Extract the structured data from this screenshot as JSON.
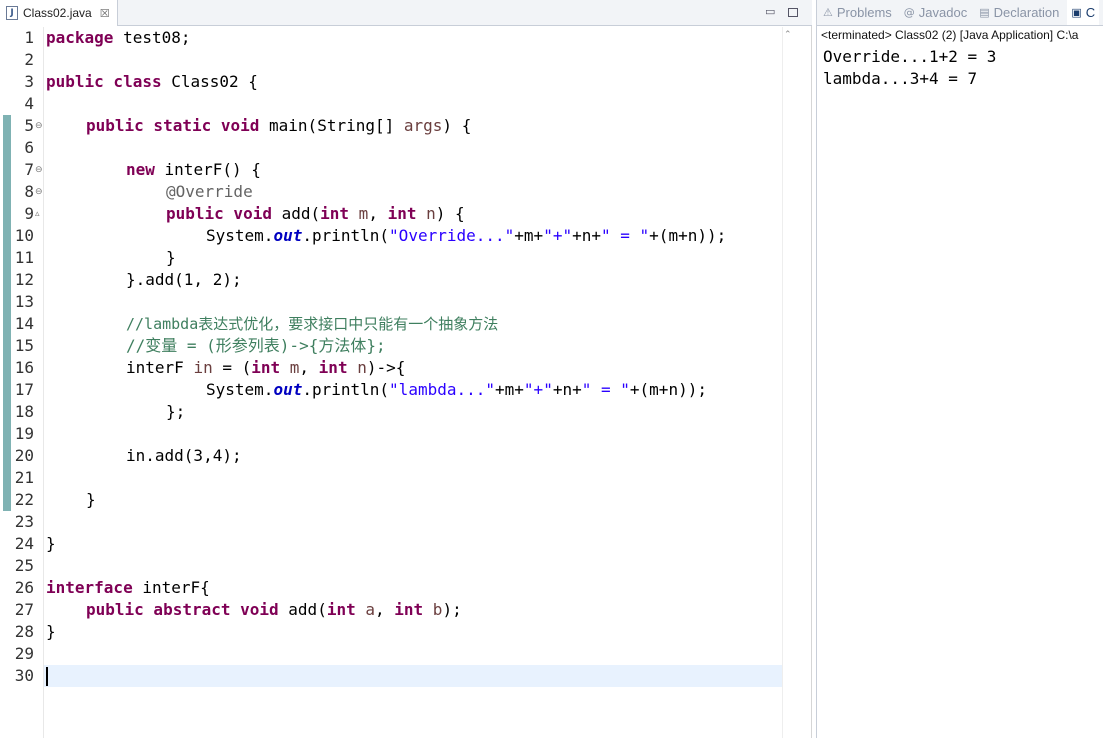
{
  "editor": {
    "tab_label": "Class02.java",
    "tab_close": "☒",
    "minimize": "▭"
  },
  "code": {
    "line_numbers": [
      "1",
      "2",
      "3",
      "4",
      "5",
      "6",
      "7",
      "8",
      "9",
      "10",
      "11",
      "12",
      "13",
      "14",
      "15",
      "16",
      "17",
      "18",
      "19",
      "20",
      "21",
      "22",
      "23",
      "24",
      "25",
      "26",
      "27",
      "28",
      "29",
      "30"
    ],
    "fold_markers": {
      "5": "⊖",
      "7": "⊖",
      "8": "⊖",
      "9": "▵"
    },
    "l1_kw": "package",
    "l1_rest": " test08;",
    "l3_kw": "public class",
    "l3_rest": " Class02 {",
    "l5_kw": "public static void",
    "l5_a": " main(String[] ",
    "l5_prm": "args",
    "l5_b": ") {",
    "l7_kw": "new",
    "l7_rest": " interF() {",
    "l8_ann": "@Override",
    "l9_kw1": "public void",
    "l9_a": " add(",
    "l9_kw2": "int",
    "l9_prm1": " m",
    "l9_b": ", ",
    "l9_kw3": "int",
    "l9_prm2": " n",
    "l9_c": ") {",
    "l10_a": "System.",
    "l10_fld": "out",
    "l10_b": ".println(",
    "l10_s1": "\"Override...\"",
    "l10_c": "+m+",
    "l10_s2": "\"+\"",
    "l10_d": "+n+",
    "l10_s3": "\" = \"",
    "l10_e": "+(m+n));",
    "l11": "}",
    "l12": "}.add(1, 2);",
    "l14_cm": "//lambda表达式优化，要求接口中只能有一个抽象方法",
    "l15_cm": "//变量 = (形参列表)->{方法体};",
    "l16_a": "interF ",
    "l16_prm1": "in",
    "l16_b": " = (",
    "l16_kw1": "int",
    "l16_prm2": " m",
    "l16_c": ", ",
    "l16_kw2": "int",
    "l16_prm3": " n",
    "l16_d": ")->{",
    "l17_a": "System.",
    "l17_fld": "out",
    "l17_b": ".println(",
    "l17_s1": "\"lambda...\"",
    "l17_c": "+m+",
    "l17_s2": "\"+\"",
    "l17_d": "+n+",
    "l17_s3": "\" = \"",
    "l17_e": "+(m+n));",
    "l18": "};",
    "l20": "in.add(3,4);",
    "l22": "}",
    "l24": "}",
    "l26_kw": "interface",
    "l26_rest": " interF{",
    "l27_kw1": "public abstract void",
    "l27_a": " add(",
    "l27_kw2": "int",
    "l27_prm1": " a",
    "l27_b": ", ",
    "l27_kw3": "int",
    "l27_prm2": " b",
    "l27_c": ");",
    "l28": "}"
  },
  "views": {
    "problems_label": "Problems",
    "javadoc_label": "Javadoc",
    "declaration_label": "Declaration",
    "console_label": "C"
  },
  "console": {
    "header": "<terminated> Class02 (2) [Java Application] C:\\a",
    "lines": [
      "Override...1+2 = 3",
      "lambda...3+4 = 7"
    ]
  },
  "colors": {
    "keyword": "#7f0055",
    "string": "#2a00ff",
    "comment": "#3f7f5f",
    "field": "#0000c0",
    "change_bar": "#7fb2b3",
    "current_line": "#e8f2fe"
  }
}
